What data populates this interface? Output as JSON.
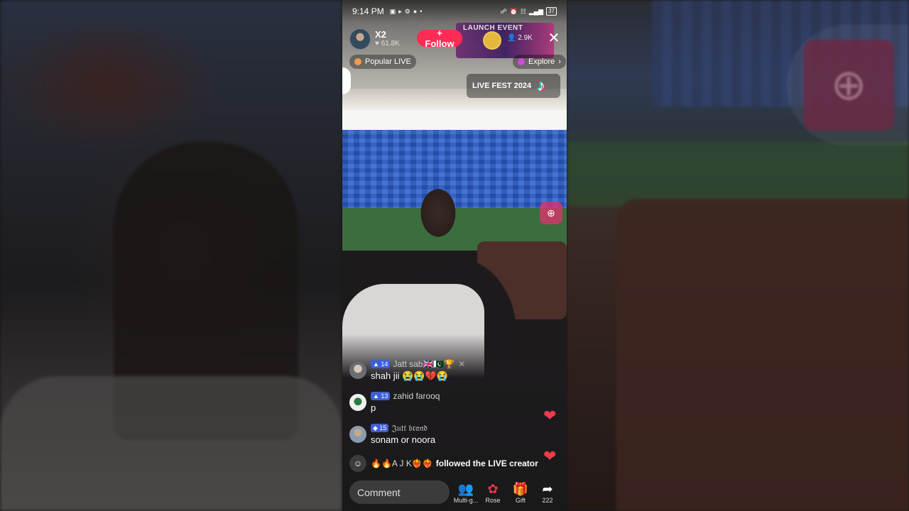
{
  "status_bar": {
    "time": "9:14 PM",
    "battery": "37"
  },
  "host": {
    "name": "X2",
    "likes": "61.8K",
    "follow_label": "+ Follow"
  },
  "banner": {
    "text": "LAUNCH EVENT"
  },
  "viewers": {
    "count": "2.9K"
  },
  "popular_pill": {
    "label": "Popular LIVE"
  },
  "explore_pill": {
    "label": "Explore"
  },
  "event_card": {
    "label": "LIVE FEST 2024"
  },
  "comments": [
    {
      "level": "14",
      "user": "Jatt sab🇬🇧🇵🇰🏆",
      "text": "shah jii 😭😭💔😭"
    },
    {
      "level": "13",
      "user": "zahid farooq",
      "text": "p"
    },
    {
      "level": "15",
      "user": "𝔍𝔲𝔱𝔱 𝔟𝔯𝔞𝔫𝔡",
      "text": "sonam or noora"
    }
  ],
  "follow_event": {
    "user": "🔥🔥A J K❤️‍🔥❤️‍🔥",
    "text": "followed the LIVE creator"
  },
  "comment_input": {
    "placeholder": "Comment"
  },
  "actions": [
    {
      "icon": "multi-guest-icon",
      "label": "Multi-g..."
    },
    {
      "icon": "rose-icon",
      "label": "Rose"
    },
    {
      "icon": "gift-icon",
      "label": "Gift"
    },
    {
      "icon": "share-icon",
      "label": "222"
    }
  ],
  "colors": {
    "accent": "#fe2c55",
    "heart": "#f23a4d",
    "level_badge": "#3f5fd6"
  }
}
